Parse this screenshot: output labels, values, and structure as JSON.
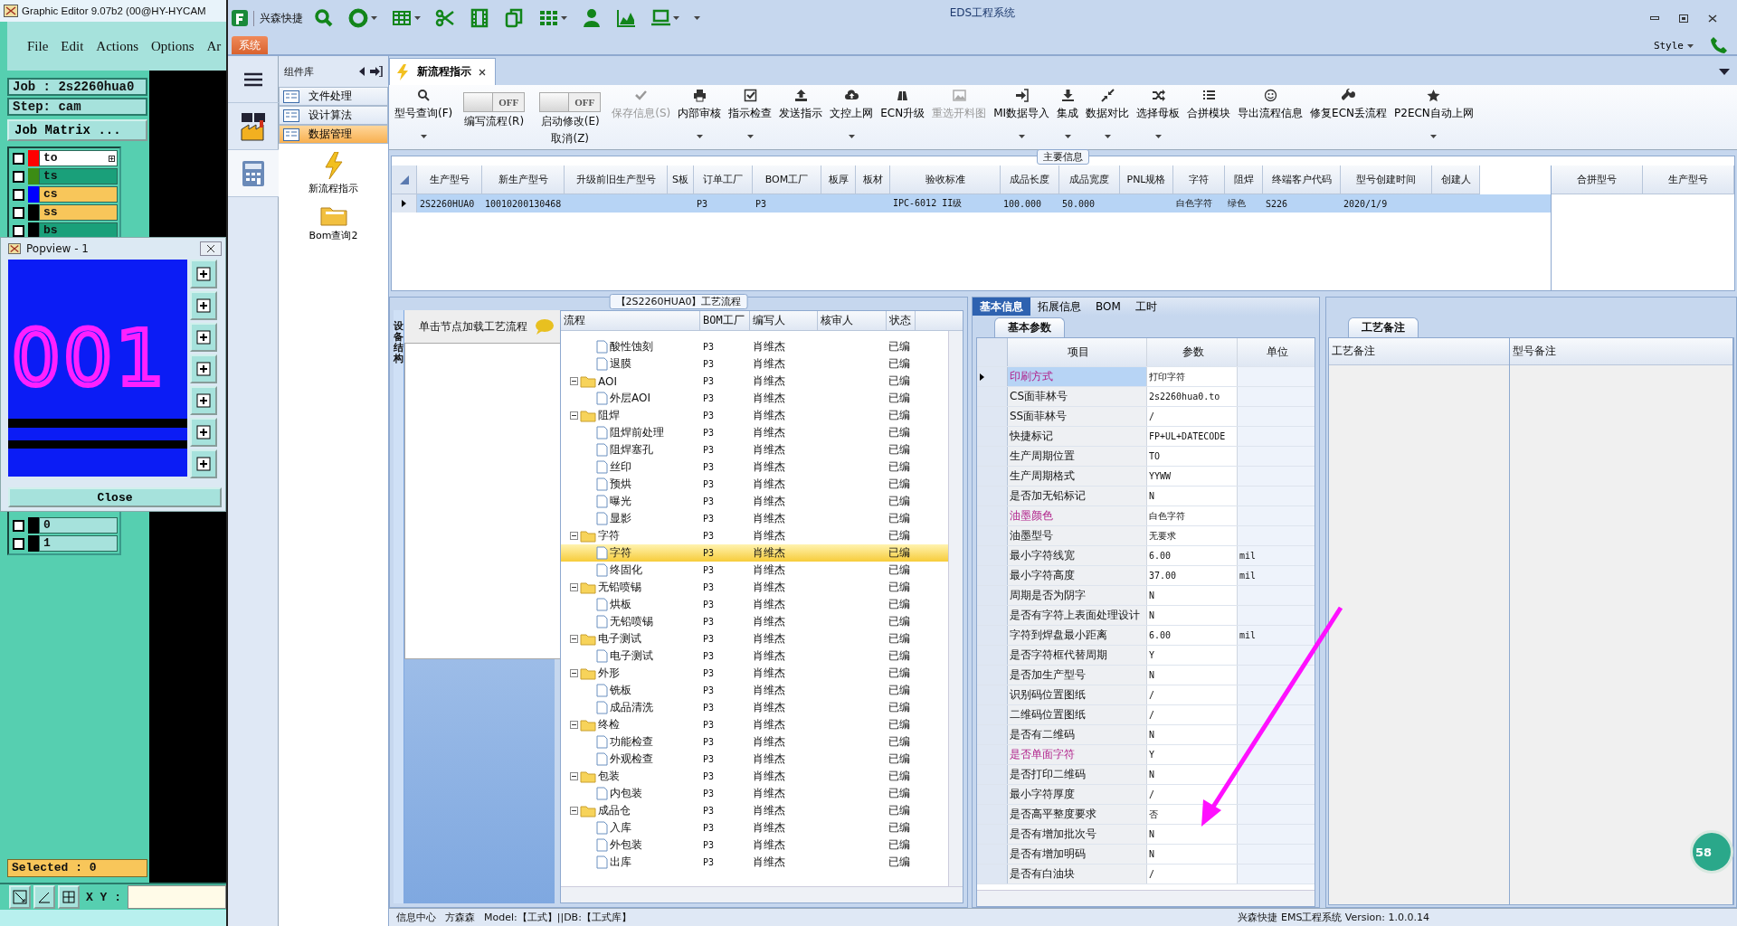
{
  "graphic_editor": {
    "title": "Graphic Editor 9.07b2 (00@HY-HYCAM",
    "menu": [
      "File",
      "Edit",
      "Actions",
      "Options",
      "Ar"
    ],
    "job": "Job : 2s2260hua0",
    "step": "Step: cam",
    "job_matrix_button": "Job Matrix ...",
    "layers": [
      {
        "name": "to",
        "color": "#ff0000",
        "kind": "board",
        "selected": true,
        "checked": false
      },
      {
        "name": "ts",
        "color": "#3c8c14",
        "kind": "board",
        "selected": false,
        "checked": false
      },
      {
        "name": "cs",
        "color": "#0000ff",
        "kind": "signal",
        "selected": false,
        "checked": false
      },
      {
        "name": "ss",
        "color": "#000000",
        "kind": "signal",
        "selected": false,
        "checked": false
      },
      {
        "name": "bs",
        "color": "#000000",
        "kind": "board",
        "selected": false,
        "checked": false
      }
    ],
    "layers_lower": [
      {
        "name": "0",
        "color": "#000000",
        "kind": "doc",
        "selected": false,
        "checked": false
      },
      {
        "name": "1",
        "color": "#000000",
        "kind": "doc",
        "selected": false,
        "checked": false
      }
    ],
    "selected_count": "Selected : 0",
    "xy_label": "X Y :"
  },
  "popview": {
    "title": "Popview - 1",
    "preview_text": "001",
    "close_button": "Close"
  },
  "window": {
    "title": "EDS工程系统",
    "quick_access": "兴森快捷",
    "system_tab": "系统",
    "style_menu": "Style"
  },
  "component_library": {
    "title": "组件库",
    "items": [
      {
        "label": "文件处理",
        "selected": false
      },
      {
        "label": "设计算法",
        "selected": false
      },
      {
        "label": "数据管理",
        "selected": true
      }
    ],
    "modules": [
      {
        "label": "新流程指示",
        "kind": "lightning"
      },
      {
        "label": "Bom查询2",
        "kind": "folder"
      }
    ]
  },
  "document_tab": {
    "label": "新流程指示"
  },
  "toolbar": [
    {
      "kind": "button",
      "label": "型号查询(F)",
      "dropdown": true,
      "disabled": false
    },
    {
      "kind": "toggle",
      "label": "编写流程(R)",
      "switch_text": "OFF",
      "on": false
    },
    {
      "kind": "toggle",
      "label": "启动修改(E)",
      "sublabel": "取消(Z)",
      "switch_text": "OFF",
      "on": false
    },
    {
      "kind": "button",
      "label": "保存信息(S)",
      "dropdown": false,
      "disabled": true
    },
    {
      "kind": "button",
      "label": "内部审核",
      "dropdown": true,
      "disabled": false
    },
    {
      "kind": "button",
      "label": "指示检查",
      "dropdown": true,
      "disabled": false
    },
    {
      "kind": "button",
      "label": "发送指示",
      "dropdown": false,
      "disabled": false
    },
    {
      "kind": "button",
      "label": "文控上网",
      "dropdown": true,
      "disabled": false
    },
    {
      "kind": "button",
      "label": "ECN升级",
      "dropdown": false,
      "disabled": false
    },
    {
      "kind": "button",
      "label": "重选开料图",
      "dropdown": false,
      "disabled": true
    },
    {
      "kind": "button",
      "label": "MI数据导入",
      "dropdown": true,
      "disabled": false
    },
    {
      "kind": "button",
      "label": "集成",
      "dropdown": true,
      "disabled": false
    },
    {
      "kind": "button",
      "label": "数据对比",
      "dropdown": true,
      "disabled": false
    },
    {
      "kind": "button",
      "label": "选择母板",
      "dropdown": true,
      "disabled": false
    },
    {
      "kind": "button",
      "label": "合拼模块",
      "dropdown": false,
      "disabled": false
    },
    {
      "kind": "button",
      "label": "导出流程信息",
      "dropdown": false,
      "disabled": false
    },
    {
      "kind": "button",
      "label": "修复ECN丢流程",
      "dropdown": false,
      "disabled": false
    },
    {
      "kind": "button",
      "label": "P2ECN自动上网",
      "dropdown": true,
      "disabled": false
    }
  ],
  "main_info": {
    "title": "主要信息",
    "columns": [
      {
        "label": "生产型号",
        "value": "2S2260HUA0"
      },
      {
        "label": "新生产型号",
        "value": "10010200130468"
      },
      {
        "label": "升级前旧生产型号"
      },
      {
        "label": "S板"
      },
      {
        "label": "订单工厂",
        "value": "P3"
      },
      {
        "label": "BOM工厂",
        "value": "P3"
      },
      {
        "label": "板厚"
      },
      {
        "label": "板材"
      },
      {
        "label": "验收标准",
        "value": "IPC-6012 II级"
      },
      {
        "label": "成品长度",
        "value": "100.000"
      },
      {
        "label": "成品宽度",
        "value": "50.000"
      },
      {
        "label": "PNL规格"
      },
      {
        "label": "字符",
        "value": "白色字符"
      },
      {
        "label": "阻焊",
        "value": "绿色"
      },
      {
        "label": "终端客户代码",
        "value": "S226"
      },
      {
        "label": "型号创建时间",
        "value": "2020/1/9"
      },
      {
        "label": "创建人"
      }
    ],
    "side_columns": [
      "合拼型号",
      "生产型号"
    ]
  },
  "process": {
    "title": "【2S2260HUA0】工艺流程",
    "side_tab": "设备结构",
    "side_header": "单击节点加载工艺流程",
    "columns": [
      "流程",
      "BOM工厂",
      "编写人",
      "核审人",
      "状态"
    ],
    "nodes": [
      {
        "children": [
          {
            "label": "酸性蚀刻",
            "bom": "P3",
            "writer": "肖维杰",
            "status": "已编",
            "selected": false
          },
          {
            "label": "退膜",
            "bom": "P3",
            "writer": "肖维杰",
            "status": "已编",
            "selected": false
          }
        ]
      },
      {
        "label": "AOI",
        "bom": "P3",
        "writer": "肖维杰",
        "status": "已编",
        "selected": false,
        "expanded": true,
        "children": [
          {
            "label": "外层AOI",
            "bom": "P3",
            "writer": "肖维杰",
            "status": "已编",
            "selected": false
          }
        ]
      },
      {
        "label": "阻焊",
        "bom": "P3",
        "writer": "肖维杰",
        "status": "已编",
        "selected": false,
        "expanded": true,
        "children": [
          {
            "label": "阻焊前处理",
            "bom": "P3",
            "writer": "肖维杰",
            "status": "已编",
            "selected": false
          },
          {
            "label": "阻焊塞孔",
            "bom": "P3",
            "writer": "肖维杰",
            "status": "已编",
            "selected": false
          },
          {
            "label": "丝印",
            "bom": "P3",
            "writer": "肖维杰",
            "status": "已编",
            "selected": false
          },
          {
            "label": "预烘",
            "bom": "P3",
            "writer": "肖维杰",
            "status": "已编",
            "selected": false
          },
          {
            "label": "曝光",
            "bom": "P3",
            "writer": "肖维杰",
            "status": "已编",
            "selected": false
          },
          {
            "label": "显影",
            "bom": "P3",
            "writer": "肖维杰",
            "status": "已编",
            "selected": false
          }
        ]
      },
      {
        "label": "字符",
        "bom": "P3",
        "writer": "肖维杰",
        "status": "已编",
        "selected": false,
        "expanded": true,
        "children": [
          {
            "label": "字符",
            "bom": "P3",
            "writer": "肖维杰",
            "status": "已编",
            "selected": true
          },
          {
            "label": "终固化",
            "bom": "P3",
            "writer": "肖维杰",
            "status": "已编",
            "selected": false
          }
        ]
      },
      {
        "label": "无铅喷锡",
        "bom": "P3",
        "writer": "肖维杰",
        "status": "已编",
        "selected": false,
        "expanded": true,
        "children": [
          {
            "label": "烘板",
            "bom": "P3",
            "writer": "肖维杰",
            "status": "已编",
            "selected": false
          },
          {
            "label": "无铅喷锡",
            "bom": "P3",
            "writer": "肖维杰",
            "status": "已编",
            "selected": false
          }
        ]
      },
      {
        "label": "电子测试",
        "bom": "P3",
        "writer": "肖维杰",
        "status": "已编",
        "selected": false,
        "expanded": true,
        "children": [
          {
            "label": "电子测试",
            "bom": "P3",
            "writer": "肖维杰",
            "status": "已编",
            "selected": false
          }
        ]
      },
      {
        "label": "外形",
        "bom": "P3",
        "writer": "肖维杰",
        "status": "已编",
        "selected": false,
        "expanded": true,
        "children": [
          {
            "label": "铣板",
            "bom": "P3",
            "writer": "肖维杰",
            "status": "已编",
            "selected": false
          },
          {
            "label": "成品清洗",
            "bom": "P3",
            "writer": "肖维杰",
            "status": "已编",
            "selected": false
          }
        ]
      },
      {
        "label": "终检",
        "bom": "P3",
        "writer": "肖维杰",
        "status": "已编",
        "selected": false,
        "expanded": true,
        "children": [
          {
            "label": "功能检查",
            "bom": "P3",
            "writer": "肖维杰",
            "status": "已编",
            "selected": false
          },
          {
            "label": "外观检查",
            "bom": "P3",
            "writer": "肖维杰",
            "status": "已编",
            "selected": false
          }
        ]
      },
      {
        "label": "包装",
        "bom": "P3",
        "writer": "肖维杰",
        "status": "已编",
        "selected": false,
        "expanded": true,
        "children": [
          {
            "label": "内包装",
            "bom": "P3",
            "writer": "肖维杰",
            "status": "已编",
            "selected": false
          }
        ]
      },
      {
        "label": "成品仓",
        "bom": "P3",
        "writer": "肖维杰",
        "status": "已编",
        "selected": false,
        "expanded": true,
        "children": [
          {
            "label": "入库",
            "bom": "P3",
            "writer": "肖维杰",
            "status": "已编",
            "selected": false
          },
          {
            "label": "外包装",
            "bom": "P3",
            "writer": "肖维杰",
            "status": "已编",
            "selected": false
          },
          {
            "label": "出库",
            "bom": "P3",
            "writer": "肖维杰",
            "status": "已编",
            "selected": false
          }
        ]
      }
    ]
  },
  "info_tabs": [
    {
      "label": "基本信息",
      "selected": true
    },
    {
      "label": "拓展信息",
      "selected": false
    },
    {
      "label": "BOM",
      "selected": false
    },
    {
      "label": "工时",
      "selected": false
    }
  ],
  "basic_params": {
    "tab": "基本参数",
    "columns": [
      "项目",
      "参数",
      "单位"
    ],
    "rows": [
      {
        "item": "印刷方式",
        "value": "打印字符",
        "highlighted": true,
        "selected": true
      },
      {
        "item": "CS面菲林号",
        "value": "2s2260hua0.to",
        "highlighted": false,
        "selected": false
      },
      {
        "item": "SS面菲林号",
        "value": "/",
        "highlighted": false,
        "selected": false
      },
      {
        "item": "快捷标记",
        "value": "FP+UL+DATECODE",
        "highlighted": false,
        "selected": false
      },
      {
        "item": "生产周期位置",
        "value": "TO",
        "highlighted": false,
        "selected": false
      },
      {
        "item": "生产周期格式",
        "value": "YYWW",
        "highlighted": false,
        "selected": false
      },
      {
        "item": "是否加无铅标记",
        "value": "N",
        "highlighted": false,
        "selected": false
      },
      {
        "item": "油墨颜色",
        "value": "白色字符",
        "highlighted": true,
        "selected": false
      },
      {
        "item": "油墨型号",
        "value": "无要求",
        "highlighted": false,
        "selected": false
      },
      {
        "item": "最小字符线宽",
        "value": "6.00",
        "unit": "mil",
        "highlighted": false,
        "selected": false
      },
      {
        "item": "最小字符高度",
        "value": "37.00",
        "unit": "mil",
        "highlighted": false,
        "selected": false
      },
      {
        "item": "周期是否为阴字",
        "value": "N",
        "highlighted": false,
        "selected": false
      },
      {
        "item": "是否有字符上表面处理设计",
        "value": "N",
        "highlighted": false,
        "selected": false
      },
      {
        "item": "字符到焊盘最小距离",
        "value": "6.00",
        "unit": "mil",
        "highlighted": false,
        "selected": false
      },
      {
        "item": "是否字符框代替周期",
        "value": "Y",
        "highlighted": false,
        "selected": false
      },
      {
        "item": "是否加生产型号",
        "value": "N",
        "highlighted": false,
        "selected": false
      },
      {
        "item": "识别码位置图纸",
        "value": "/",
        "highlighted": false,
        "selected": false
      },
      {
        "item": "二维码位置图纸",
        "value": "/",
        "highlighted": false,
        "selected": false
      },
      {
        "item": "是否有二维码",
        "value": "N",
        "highlighted": false,
        "selected": false
      },
      {
        "item": "是否单面字符",
        "value": "Y",
        "highlighted": true,
        "selected": false
      },
      {
        "item": "是否打印二维码",
        "value": "N",
        "highlighted": false,
        "selected": false
      },
      {
        "item": "最小字符厚度",
        "value": "/",
        "highlighted": false,
        "selected": false
      },
      {
        "item": "是否高平整度要求",
        "value": "否",
        "highlighted": false,
        "selected": false
      },
      {
        "item": "是否有增加批次号",
        "value": "N",
        "highlighted": false,
        "selected": false
      },
      {
        "item": "是否有增加明码",
        "value": "N",
        "highlighted": false,
        "selected": false
      },
      {
        "item": "是否有白油块",
        "value": "/",
        "highlighted": false,
        "selected": false
      }
    ]
  },
  "remarks": {
    "tab": "工艺备注",
    "columns": [
      "工艺备注",
      "型号备注"
    ]
  },
  "floating_badge": "58",
  "status_bar": {
    "info_center": "信息中心",
    "user": "方森森",
    "model_db": "Model:【工式】||DB:【工式库】",
    "version": "兴森快捷  EMS工程系统  Version: 1.0.0.14"
  }
}
